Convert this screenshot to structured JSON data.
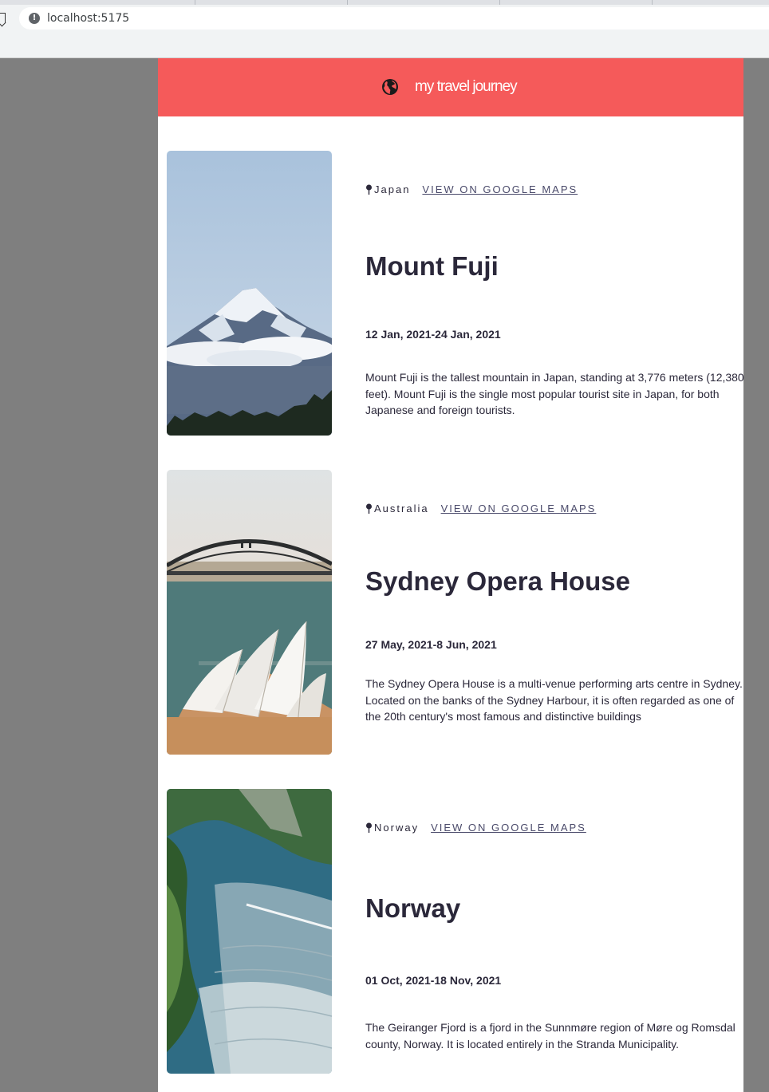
{
  "browser": {
    "url": "localhost:5175"
  },
  "header": {
    "title": "my travel journey",
    "icon": "globe-icon",
    "background_color": "#f55a5a"
  },
  "entries": [
    {
      "location": "Japan",
      "maps_link_label": "VIEW ON GOOGLE MAPS",
      "title": "Mount Fuji",
      "dates": "12 Jan, 2021-24 Jan, 2021",
      "description": "Mount Fuji is the tallest mountain in Japan, standing at 3,776 meters (12,380 feet). Mount Fuji is the single most popular tourist site in Japan, for both Japanese and foreign tourists."
    },
    {
      "location": "Australia",
      "maps_link_label": "VIEW ON GOOGLE MAPS",
      "title": "Sydney Opera House",
      "dates": "27 May, 2021-8 Jun, 2021",
      "description": "The Sydney Opera House is a multi-venue performing arts centre in Sydney. Located on the banks of the Sydney Harbour, it is often regarded as one of the 20th century's most famous and distinctive buildings"
    },
    {
      "location": "Norway",
      "maps_link_label": "VIEW ON GOOGLE MAPS",
      "title": "Norway",
      "dates": "01 Oct, 2021-18 Nov, 2021",
      "description": "The Geiranger Fjord is a fjord in the Sunnmøre region of Møre og Romsdal county, Norway. It is located entirely in the Stranda Municipality."
    }
  ]
}
